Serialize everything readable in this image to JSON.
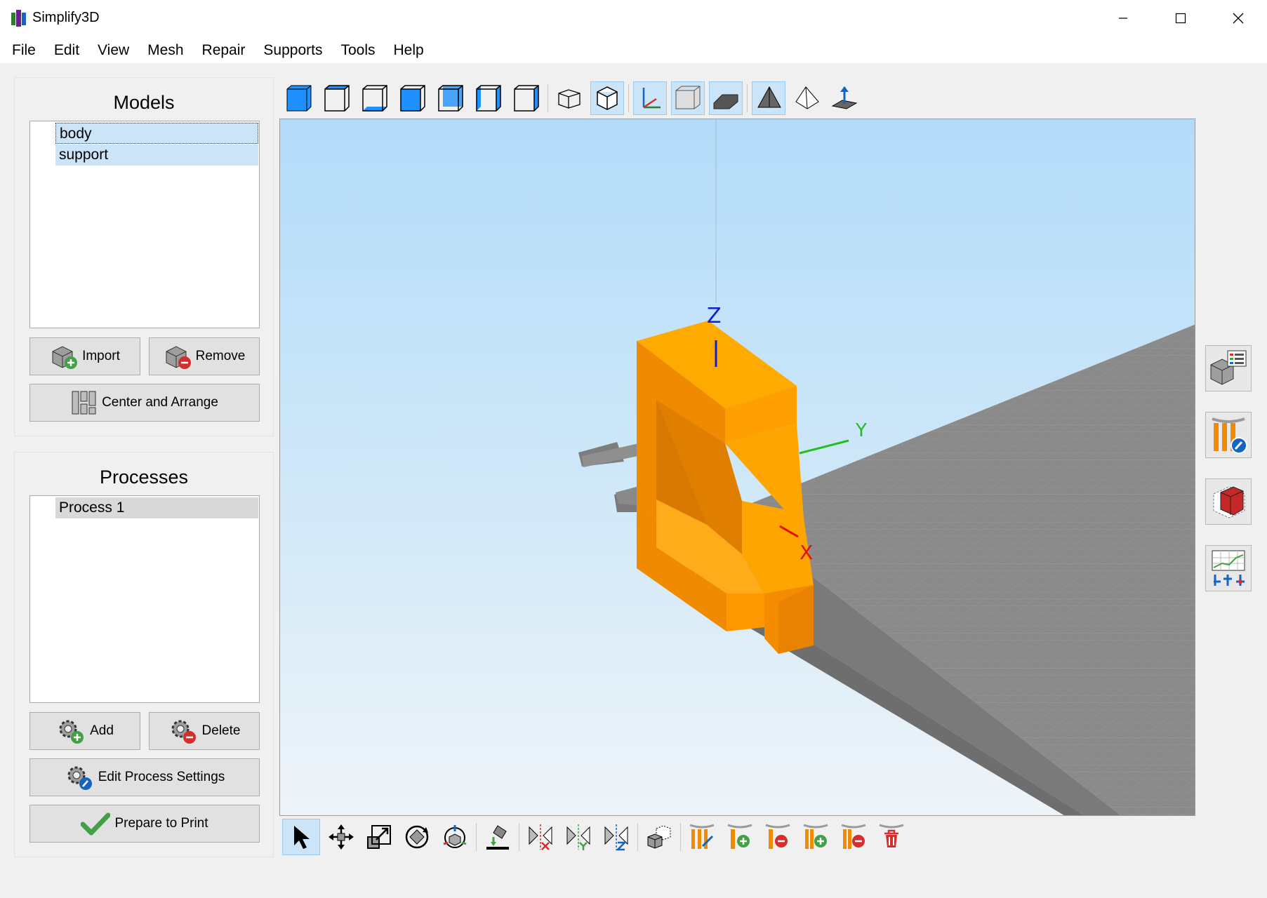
{
  "app": {
    "title": "Simplify3D"
  },
  "menu": [
    "File",
    "Edit",
    "View",
    "Mesh",
    "Repair",
    "Supports",
    "Tools",
    "Help"
  ],
  "models": {
    "title": "Models",
    "items": [
      "body",
      "support"
    ],
    "import_label": "Import",
    "remove_label": "Remove",
    "arrange_label": "Center and Arrange"
  },
  "processes": {
    "title": "Processes",
    "items": [
      "Process 1"
    ],
    "add_label": "Add",
    "delete_label": "Delete",
    "edit_label": "Edit Process Settings",
    "prepare_label": "Prepare to Print"
  },
  "axes": {
    "x": "X",
    "y": "Y",
    "z": "Z"
  },
  "colors": {
    "model": "#ffa500",
    "model_shade": "#e07e00",
    "sky_top": "#b3dcfa",
    "bed": "#8a8a8a",
    "selection": "#cce4f7",
    "accent_green": "#4caf50",
    "accent_red": "#d32f2f",
    "accent_blue": "#1565c0"
  },
  "icons": {
    "view_toolbar": [
      "view-iso-icon",
      "view-top-icon",
      "view-bottom-icon",
      "view-front-icon",
      "view-back-icon",
      "view-left-icon",
      "view-right-icon",
      "perspective-icon",
      "orthographic-icon",
      "axes-icon",
      "build-volume-icon",
      "bed-icon",
      "shaded-icon",
      "wireframe-icon",
      "normals-icon"
    ],
    "edit_toolbar": [
      "select-icon",
      "move-icon",
      "scale-icon",
      "rotate-icon",
      "rotate-3d-icon",
      "place-on-bed-icon",
      "mirror-x-icon",
      "mirror-y-icon",
      "mirror-z-icon",
      "copy-model-icon",
      "support-generate-icon",
      "support-add-icon",
      "support-remove-icon",
      "support-add-row-icon",
      "support-remove-row-icon",
      "support-delete-icon"
    ],
    "side": [
      "model-properties-icon",
      "customize-supports-icon",
      "cross-section-icon",
      "variable-settings-icon"
    ]
  }
}
